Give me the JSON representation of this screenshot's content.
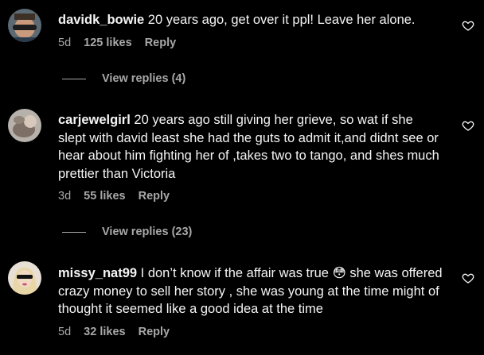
{
  "comments": [
    {
      "username": "davidk_bowie",
      "text": " 20 years ago, get over it ppl! Leave her alone.",
      "time": "5d",
      "likes": "125 likes",
      "reply": "Reply",
      "view_replies": "View replies (4)"
    },
    {
      "username": "carjewelgirl",
      "text": " 20 years ago still giving her grieve, so wat if she slept with david least she had the guts to admit it,and didnt see or hear about him fighting her of ,takes two to tango, and shes much prettier than Victoria",
      "time": "3d",
      "likes": "55 likes",
      "reply": "Reply",
      "view_replies": "View replies (23)"
    },
    {
      "username": "missy_nat99",
      "text_before": " I don’t know if the affair was true ",
      "emoji": "😳",
      "text_after": "  she was offered crazy money to sell her story , she was young at the time might of thought it seemed like a good idea at the time",
      "time": "5d",
      "likes": "32 likes",
      "reply": "Reply"
    }
  ],
  "icons": {
    "like": "heart-outline-icon"
  }
}
